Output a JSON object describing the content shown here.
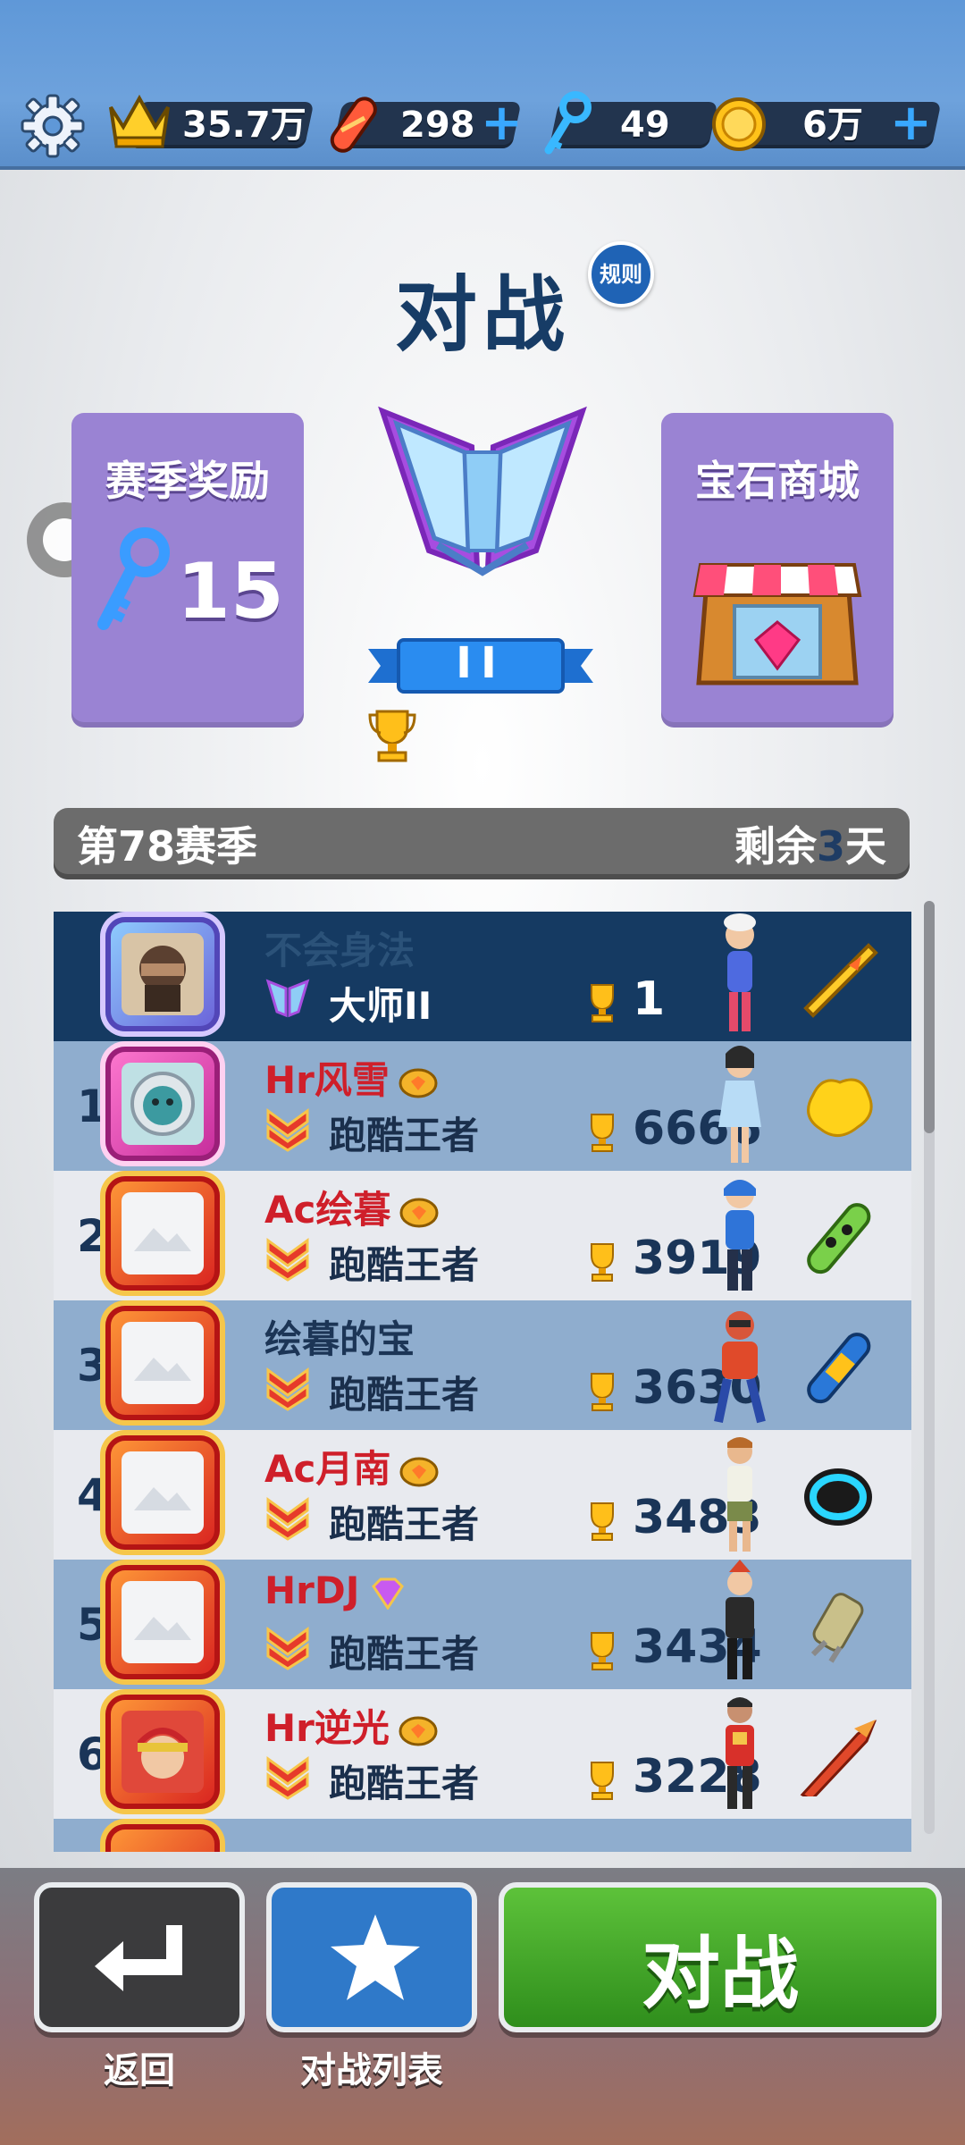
{
  "resources": {
    "crowns": "35.7万",
    "hoverboards": "298",
    "keys": "49",
    "coins": "6万",
    "plus": "+"
  },
  "header": {
    "title": "对战",
    "rules_label": "规则"
  },
  "left_card": {
    "title": "赛季奖励",
    "key_count": "15"
  },
  "right_card": {
    "title": "宝石商城"
  },
  "rank_badge": {
    "tier_ribbon": "II"
  },
  "season": {
    "name": "第78赛季",
    "remain_prefix": "剩余",
    "remain_days": "3",
    "remain_suffix": "天"
  },
  "self_row": {
    "name": "不会身法",
    "title": "大师II",
    "score": "1"
  },
  "leaderboard": [
    {
      "rank": "1",
      "name": "Hr风雪",
      "title": "跑酷王者",
      "score": "6666"
    },
    {
      "rank": "2",
      "name": "Ac绘暮",
      "title": "跑酷王者",
      "score": "3919"
    },
    {
      "rank": "3",
      "name": "绘暮的宝",
      "title": "跑酷王者",
      "score": "3630"
    },
    {
      "rank": "4",
      "name": "Ac月南",
      "title": "跑酷王者",
      "score": "3483"
    },
    {
      "rank": "5",
      "name": "HrDJ",
      "title": "跑酷王者",
      "score": "3434"
    },
    {
      "rank": "6",
      "name": "Hr逆光",
      "title": "跑酷王者",
      "score": "3228"
    }
  ],
  "bottom": {
    "back_label": "返回",
    "list_label": "对战列表",
    "battle_label": "对战"
  },
  "colors": {
    "accent_blue": "#1f63b5",
    "battle_green": "#3ea12c",
    "card_purple": "#9a83d3",
    "name_red": "#cf1f2a"
  },
  "icons": [
    "gear-icon",
    "crown-icon",
    "hoverboard-icon",
    "key-icon",
    "coin-icon",
    "trophy-icon",
    "return-arrow-icon",
    "star-icon"
  ]
}
